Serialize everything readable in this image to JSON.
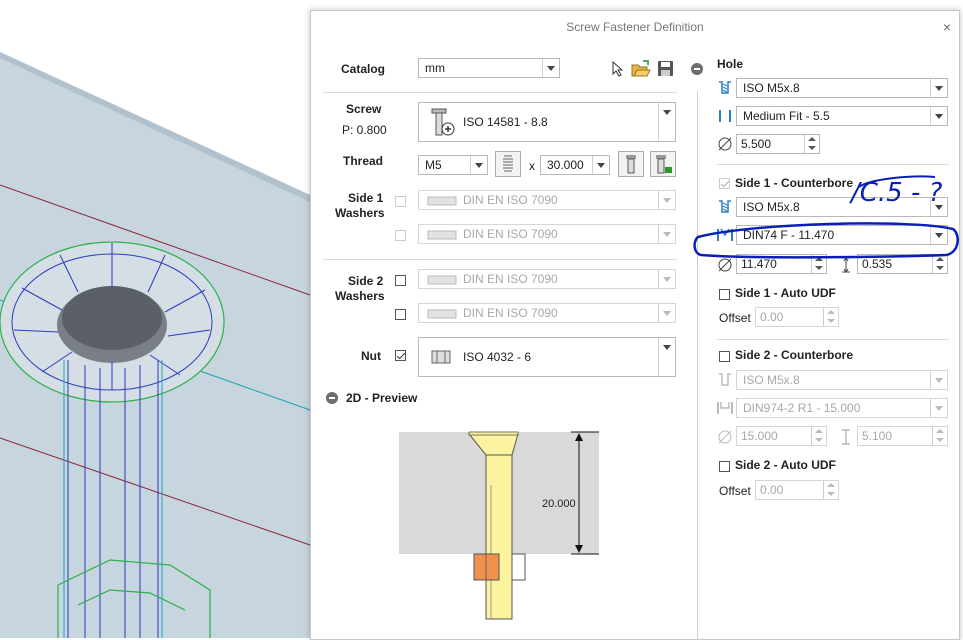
{
  "dialog": {
    "title": "Screw Fastener Definition",
    "close": "×"
  },
  "catalog": {
    "label": "Catalog",
    "value": "mm"
  },
  "screw": {
    "label": "Screw",
    "pitch": "P: 0.800",
    "value": "ISO 14581 - 8.8"
  },
  "thread": {
    "label": "Thread",
    "size": "M5",
    "times": "x",
    "length": "30.000"
  },
  "side1_washers": {
    "label_line1": "Side 1",
    "label_line2": "Washers",
    "item1": "DIN EN ISO 7090",
    "item2": "DIN EN ISO 7090"
  },
  "side2_washers": {
    "label_line1": "Side 2",
    "label_line2": "Washers",
    "item1": "DIN EN ISO 7090",
    "item2": "DIN EN ISO 7090"
  },
  "nut": {
    "label": "Nut",
    "value": "ISO 4032 - 6"
  },
  "preview": {
    "label": "2D - Preview",
    "dimension": "20.000"
  },
  "hole": {
    "label": "Hole",
    "standard": "ISO M5x.8",
    "fit": "Medium Fit - 5.5",
    "diameter": "5.500"
  },
  "side1_counterbore": {
    "label": "Side 1 - Counterbore",
    "standard": "ISO M5x.8",
    "type": "DIN74 F - 11.470",
    "diameter": "11.470",
    "depth": "0.535",
    "annotation": "/C.5 - ?"
  },
  "side1_auto_udf": {
    "label": "Side 1 - Auto UDF",
    "offset_label": "Offset",
    "offset": "0.00"
  },
  "side2_counterbore": {
    "label": "Side 2 - Counterbore",
    "standard": "ISO M5x.8",
    "type": "DIN974-2 R1 - 15.000",
    "diameter": "15.000",
    "depth": "5.100"
  },
  "side2_auto_udf": {
    "label": "Side 2 - Auto UDF",
    "offset_label": "Offset",
    "offset": "0.00"
  },
  "colors": {
    "viewport_bg": "#c6d4de",
    "annotation": "#0a1fb5",
    "screw_fill": "#fbf3a0",
    "nut_fill": "#f0924e"
  }
}
